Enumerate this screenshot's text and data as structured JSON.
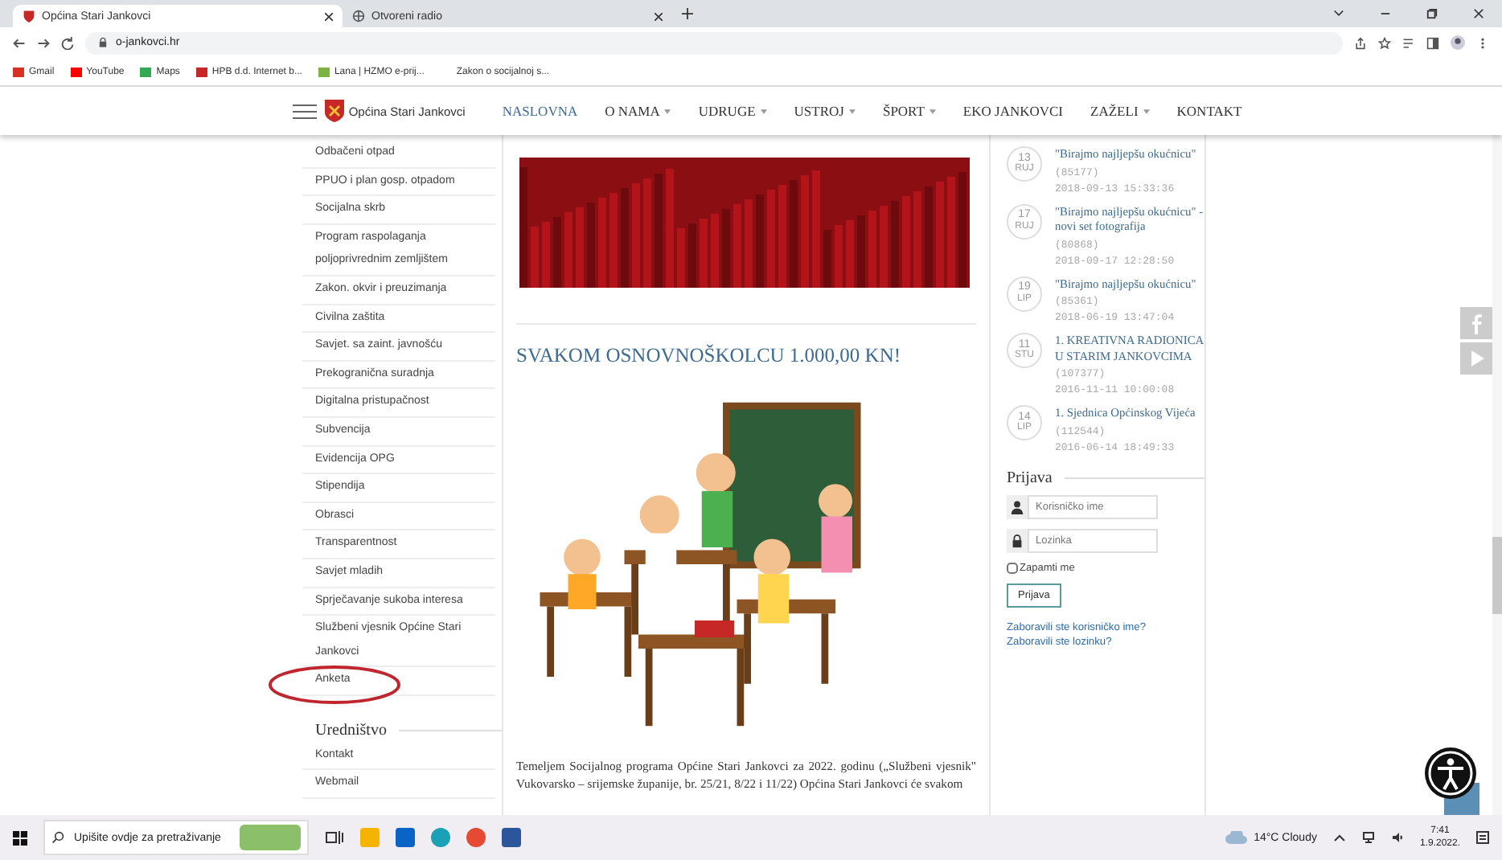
{
  "browser": {
    "tabs": [
      {
        "title": "Općina Stari Jankovci",
        "selected": true
      },
      {
        "title": "Otvoreni radio",
        "selected": false
      }
    ],
    "url": "o-jankovci.hr",
    "bookmarks": [
      "Gmail",
      "YouTube",
      "Maps",
      "HPB d.d. Internet b...",
      "Lana | HZMO e-prij...",
      "Zakon o socijalnoj s..."
    ]
  },
  "site_nav": {
    "brand": "Općina Stari Jankovci",
    "items": [
      {
        "label": "NASLOVNA",
        "selected": true,
        "dropdown": false
      },
      {
        "label": "O NAMA",
        "selected": false,
        "dropdown": true
      },
      {
        "label": "UDRUGE",
        "selected": false,
        "dropdown": true
      },
      {
        "label": "USTROJ",
        "selected": false,
        "dropdown": true
      },
      {
        "label": "ŠPORT",
        "selected": false,
        "dropdown": true
      },
      {
        "label": "EKO JANKOVCI",
        "selected": false,
        "dropdown": false
      },
      {
        "label": "ZAŽELI",
        "selected": false,
        "dropdown": true
      },
      {
        "label": "KONTAKT",
        "selected": false,
        "dropdown": false
      }
    ]
  },
  "sidebar": {
    "items": [
      {
        "label": "Odbačeni otpad",
        "circled": false
      },
      {
        "label": "PPUO i plan gosp. otpadom",
        "circled": false
      },
      {
        "label": "Socijalna skrb",
        "circled": false
      },
      {
        "label": "Program raspolaganja poljoprivrednim zemljištem",
        "circled": false
      },
      {
        "label": "Zakon. okvir i preuzimanja",
        "circled": false
      },
      {
        "label": "Civilna zaštita",
        "circled": false
      },
      {
        "label": "Savjet. sa zaint. javnošću",
        "circled": false
      },
      {
        "label": "Prekogranična suradnja",
        "circled": false
      },
      {
        "label": "Digitalna pristupačnost",
        "circled": false
      },
      {
        "label": "Subvencija",
        "circled": false
      },
      {
        "label": "Evidencija OPG",
        "circled": false
      },
      {
        "label": "Stipendija",
        "circled": false
      },
      {
        "label": "Obrasci",
        "circled": false
      },
      {
        "label": "Transparentnost",
        "circled": false
      },
      {
        "label": "Savjet mladih",
        "circled": false
      },
      {
        "label": "Sprječavanje sukoba interesa",
        "circled": false
      },
      {
        "label": "Službeni vjesnik Općine Stari Jankovci",
        "circled": false
      },
      {
        "label": "Anketa",
        "circled": true
      }
    ],
    "section": {
      "title": "Uredništvo",
      "items": [
        "Kontakt",
        "Webmail"
      ]
    }
  },
  "article": {
    "title": "SVAKOM OSNOVNOŠKOLCU 1.000,00 KN!",
    "text": "Temeljem Socijalnog programa Općine Stari Jankovci za 2022. godinu („Službeni vjesnik\" Vukovarsko – srijemske županije, br. 25/21, 8/22 i 11/22) Općina Stari Jankovci će svakom"
  },
  "popular": [
    {
      "day": "13",
      "month": "RUJ",
      "title": "\"Birajmo najljepšu okućnicu\"",
      "views": "(85177)",
      "date": "2018-09-13 15:33:36"
    },
    {
      "day": "17",
      "month": "RUJ",
      "title": "\"Birajmo najljepšu okućnicu\" - novi set fotografija",
      "views": "(80868)",
      "date": "2018-09-17 12:28:50"
    },
    {
      "day": "19",
      "month": "LIP",
      "title": "\"Birajmo najljepšu okućnicu\"",
      "views": "(85361)",
      "date": "2018-06-19 13:47:04"
    },
    {
      "day": "11",
      "month": "STU",
      "title": "1. KREATIVNA RADIONICA U STARIM JANKOVCIMA",
      "views": "(107377)",
      "date": "2016-11-11 10:00:08"
    },
    {
      "day": "14",
      "month": "LIP",
      "title": "1. Sjednica Općinskog Vijeća",
      "views": "(112544)",
      "date": "2016-06-14 18:49:33"
    }
  ],
  "login": {
    "title": "Prijava",
    "username_placeholder": "Korisničko ime",
    "password_placeholder": "Lozinka",
    "remember": {
      "label": "Zapamti me",
      "checked": false
    },
    "button": "Prijava",
    "links": [
      "Zaboravili ste korisničko ime?",
      "Zaboravili ste lozinku?"
    ]
  },
  "taskbar": {
    "search_placeholder": "Upišite ovdje za pretraživanje",
    "weather": "14°C  Cloudy",
    "time": "7:41",
    "date": "1.9.2022."
  }
}
